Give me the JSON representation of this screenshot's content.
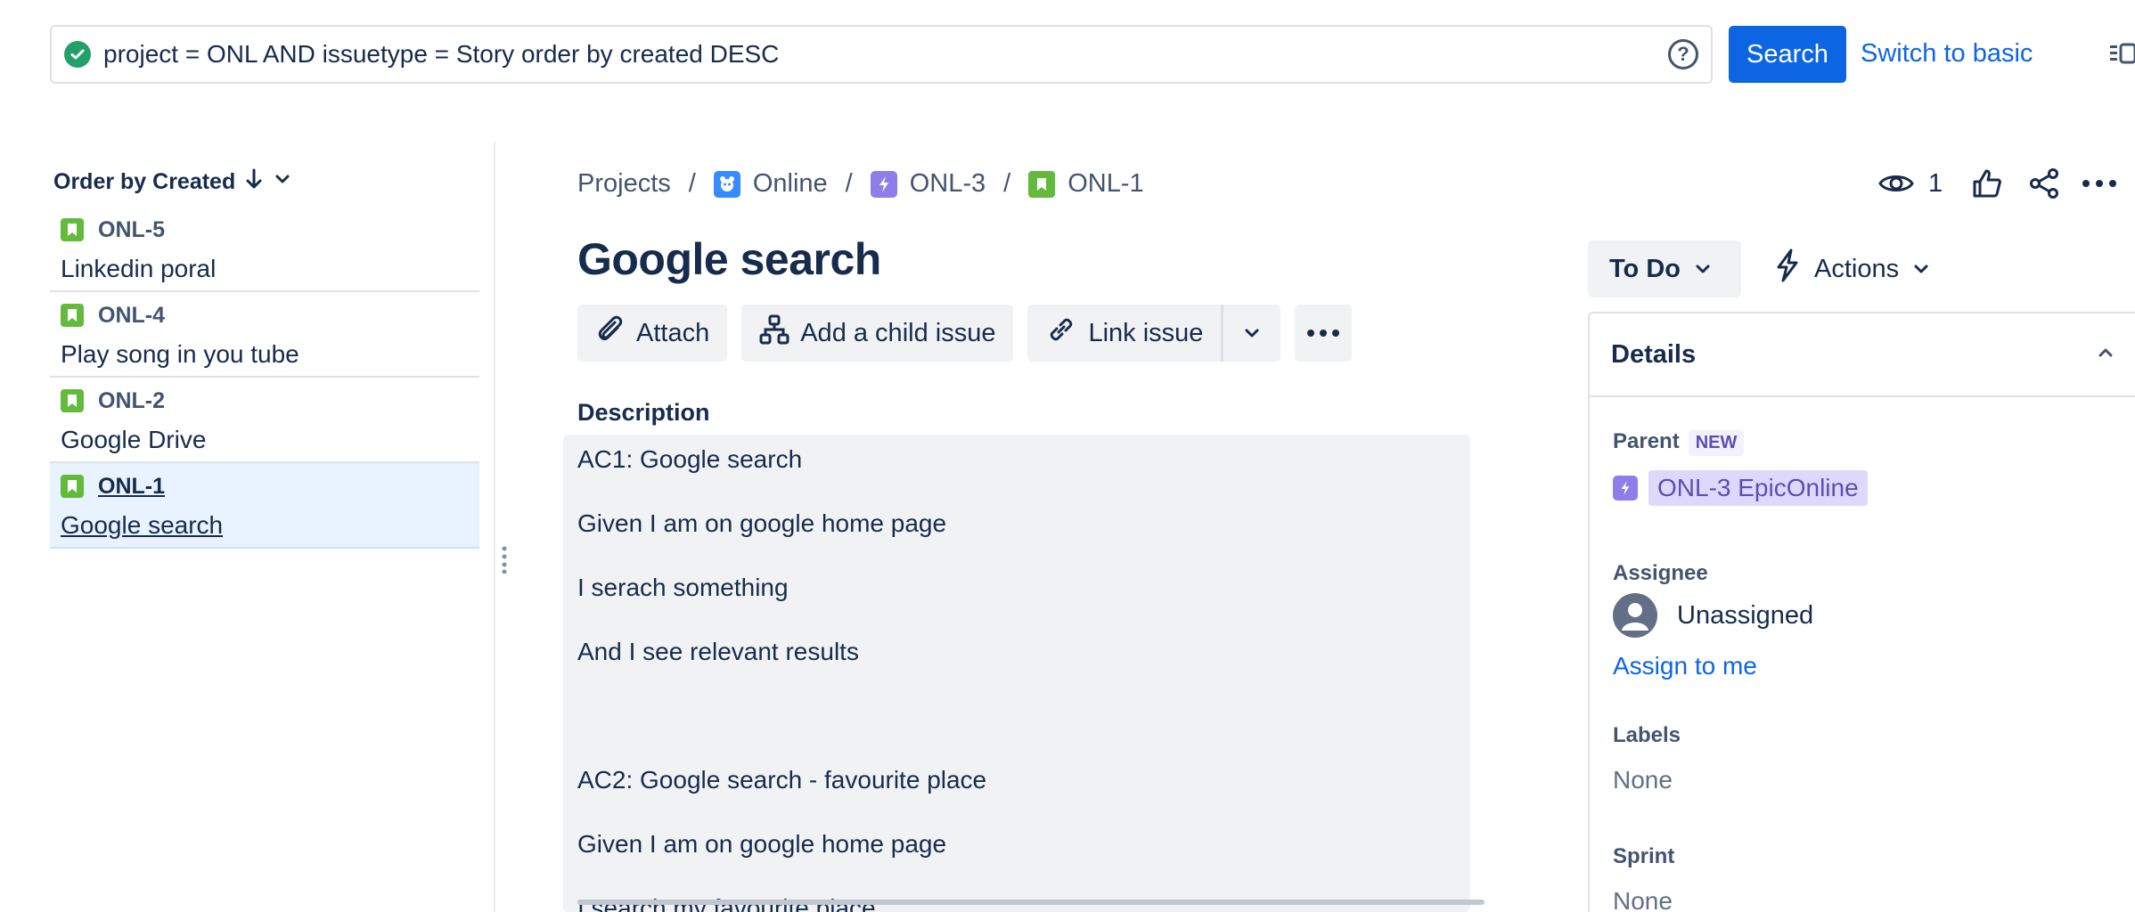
{
  "search": {
    "jql": "project = ONL AND issuetype = Story order by created DESC",
    "search_label": "Search",
    "switch_label": "Switch to basic"
  },
  "list": {
    "order_label": "Order by Created",
    "items": [
      {
        "key": "ONL-5",
        "title": "Linkedin poral"
      },
      {
        "key": "ONL-4",
        "title": "Play song in you tube"
      },
      {
        "key": "ONL-2",
        "title": "Google Drive"
      },
      {
        "key": "ONL-1",
        "title": "Google search"
      }
    ]
  },
  "breadcrumb": {
    "projects": "Projects",
    "project": "Online",
    "epic": "ONL-3",
    "issue": "ONL-1",
    "sep": "/"
  },
  "header": {
    "watch_count": "1"
  },
  "issue": {
    "title": "Google search"
  },
  "toolbar": {
    "attach": "Attach",
    "add_child": "Add a child issue",
    "link_issue": "Link issue"
  },
  "description": {
    "label": "Description",
    "lines": [
      "AC1:  Google search",
      "Given I am on google home page",
      "I serach something",
      "And I see relevant results",
      "",
      "AC2:  Google search - favourite place",
      "Given I am on google home page",
      "I search my favourite place"
    ]
  },
  "status": {
    "label": "To Do",
    "actions": "Actions"
  },
  "details": {
    "title": "Details",
    "parent_label": "Parent",
    "new_badge": "NEW",
    "parent_value": "ONL-3 EpicOnline",
    "assignee_label": "Assignee",
    "assignee_value": "Unassigned",
    "assign_to_me": "Assign to me",
    "labels_label": "Labels",
    "labels_value": "None",
    "sprint_label": "Sprint",
    "sprint_value": "None"
  },
  "colors": {
    "primary": "#0c66e4",
    "story": "#63ba3c",
    "epic": "#8f7ee7",
    "selected_bg": "#e9f2ff",
    "success": "#22a06b"
  }
}
